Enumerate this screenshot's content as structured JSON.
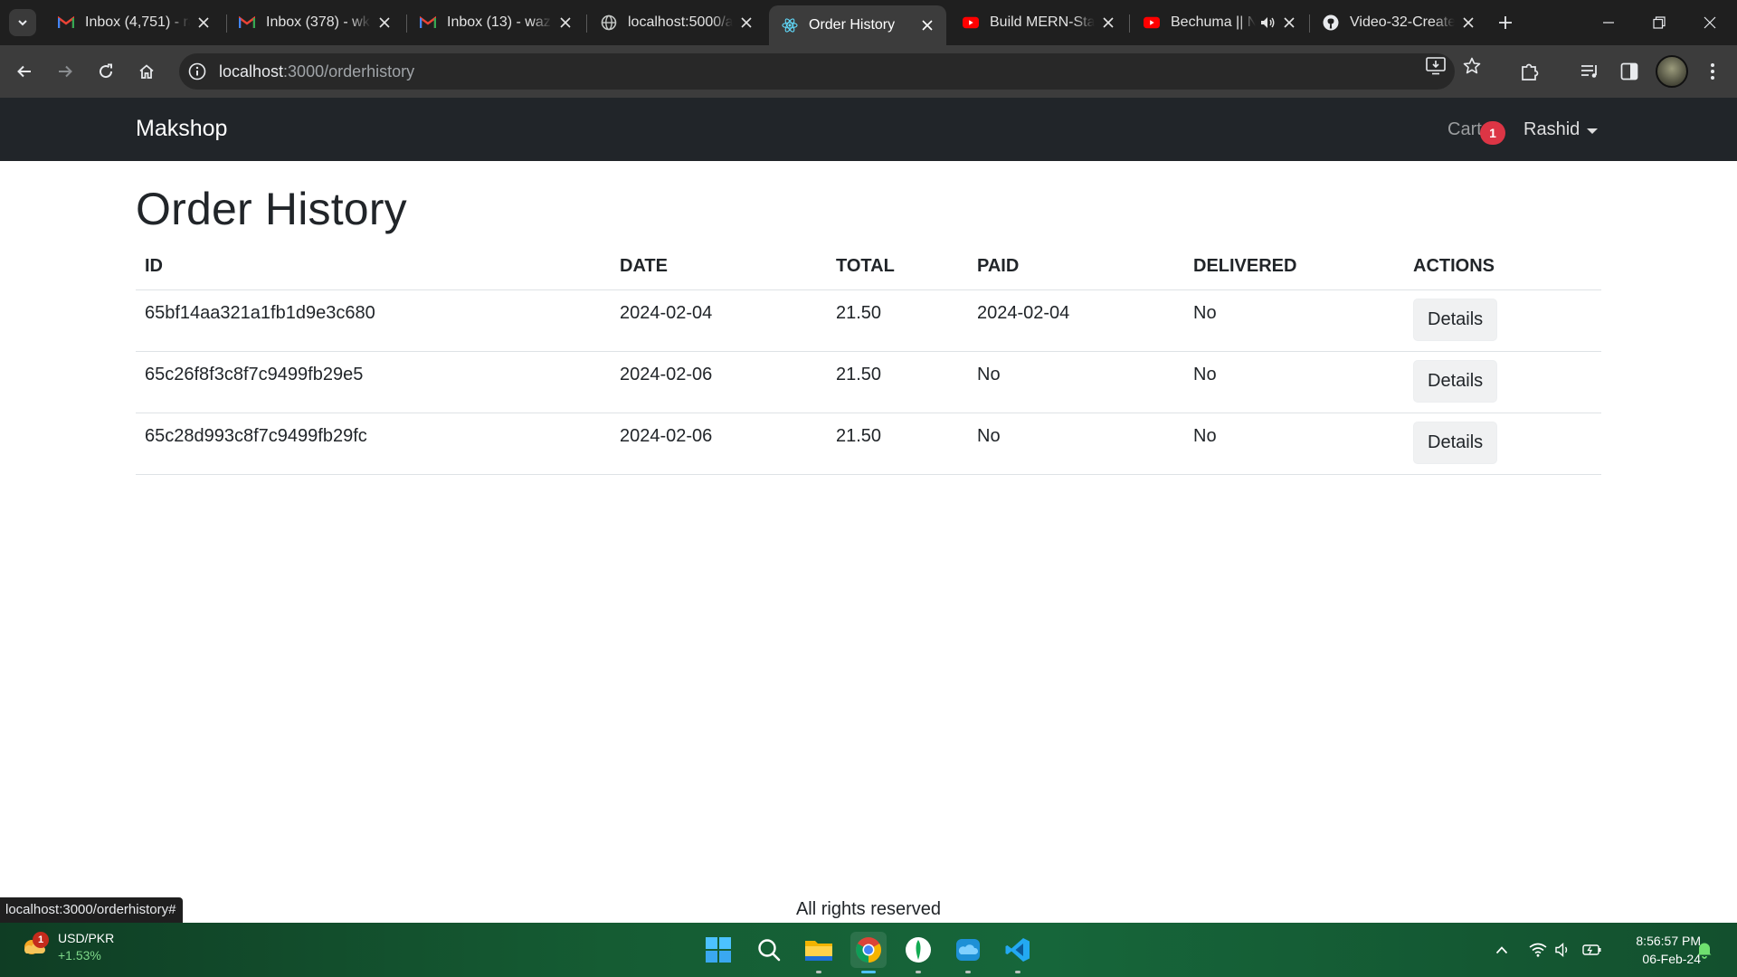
{
  "browser": {
    "tabs": [
      {
        "title": "Inbox (4,751) - ra",
        "icon": "gmail-icon",
        "active": false
      },
      {
        "title": "Inbox (378) - wk",
        "icon": "gmail-icon",
        "active": false
      },
      {
        "title": "Inbox (13) - waz",
        "icon": "gmail-icon",
        "active": false
      },
      {
        "title": "localhost:5000/a",
        "icon": "globe-icon",
        "active": false
      },
      {
        "title": "Order History",
        "icon": "react-icon",
        "active": true
      },
      {
        "title": "Build MERN-Sta",
        "icon": "youtube-icon",
        "active": false
      },
      {
        "title": "Bechuma || N",
        "icon": "youtube-icon",
        "active": false
      },
      {
        "title": "Video-32-Create",
        "icon": "github-icon",
        "active": false
      }
    ],
    "address": {
      "host": "localhost",
      "rest": ":3000/orderhistory"
    },
    "status_url": "localhost:3000/orderhistory#"
  },
  "navbar": {
    "brand": "Makshop",
    "cart_label": "Cart",
    "cart_count": "1",
    "user_name": "Rashid"
  },
  "page": {
    "title": "Order History",
    "columns": [
      "ID",
      "DATE",
      "TOTAL",
      "PAID",
      "DELIVERED",
      "ACTIONS"
    ],
    "orders": [
      {
        "id": "65bf14aa321a1fb1d9e3c680",
        "date": "2024-02-04",
        "total": "21.50",
        "paid": "2024-02-04",
        "delivered": "No",
        "action": "Details"
      },
      {
        "id": "65c26f8f3c8f7c9499fb29e5",
        "date": "2024-02-06",
        "total": "21.50",
        "paid": "No",
        "delivered": "No",
        "action": "Details"
      },
      {
        "id": "65c28d993c8f7c9499fb29fc",
        "date": "2024-02-06",
        "total": "21.50",
        "paid": "No",
        "delivered": "No",
        "action": "Details"
      }
    ],
    "footer": "All rights reserved"
  },
  "taskbar": {
    "widget": {
      "pair": "USD/PKR",
      "change": "+1.53%",
      "badge": "1"
    },
    "apps": [
      "windows-start-icon",
      "search-icon",
      "file-explorer-icon",
      "chrome-icon",
      "mongodb-compass-icon",
      "onedrive-icon",
      "vscode-icon"
    ],
    "time": "8:56:57 PM",
    "date": "06-Feb-24"
  },
  "colors": {
    "navbar_bg": "#212529",
    "badge_red": "#dc3545",
    "taskbar_green": "#16663a"
  }
}
